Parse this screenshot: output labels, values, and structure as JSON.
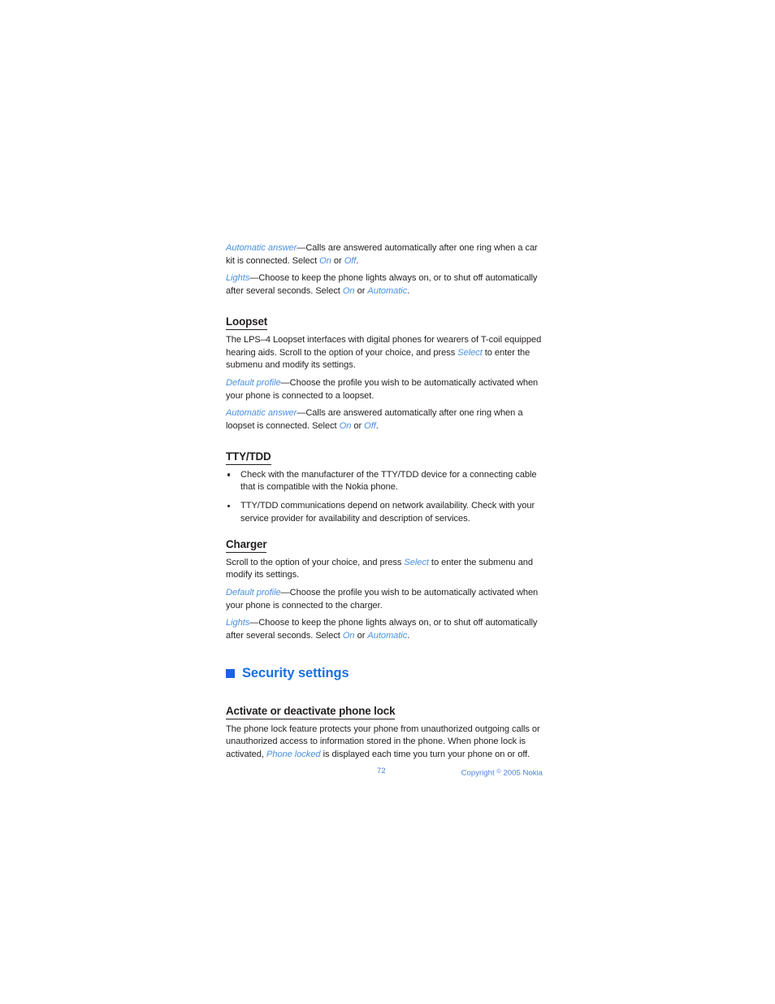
{
  "page": {
    "background_color": "#ffffff",
    "text_color": "#231f20",
    "accent_blue": "#4a90e2",
    "heading_blue": "#1a6fe0",
    "square_blue": "#1a62e8"
  },
  "intro": {
    "automatic_answer": {
      "term": "Automatic answer",
      "text_1": "—Calls are answered automatically after one ring when a car kit is connected. Select ",
      "option_1": "On",
      "conj": " or ",
      "option_2": "Off",
      "text_end": "."
    },
    "lights": {
      "term": "Lights",
      "text_1": "—Choose to keep the phone lights always on, or to shut off automatically after several seconds. Select ",
      "option_1": "On",
      "conj": " or ",
      "option_2": "Automatic",
      "text_end": "."
    }
  },
  "loopset": {
    "heading": "Loopset",
    "intro": {
      "text_1": "The LPS–4 Loopset interfaces with digital phones for wearers of T-coil equipped hearing aids. Scroll to the option of your choice, and press ",
      "keyword": "Select",
      "text_2": " to enter the submenu and modify its settings."
    },
    "default_profile": {
      "term": "Default profile",
      "text": "—Choose the profile you wish to be automatically activated when your phone is connected to a loopset."
    },
    "automatic_answer": {
      "term": "Automatic answer",
      "text_1": "—Calls are answered automatically after one ring when a loopset is connected. Select ",
      "option_1": "On",
      "conj": " or ",
      "option_2": "Off",
      "text_end": "."
    }
  },
  "tty_tdd": {
    "heading": "TTY/TDD",
    "bullets": [
      "Check with the manufacturer of the TTY/TDD device for a connecting cable that is compatible with the Nokia phone.",
      "TTY/TDD communications depend on network availability. Check with your service provider for availability and description of services."
    ]
  },
  "charger": {
    "heading": "Charger",
    "intro": {
      "text_1": "Scroll to the option of your choice, and press ",
      "keyword": "Select",
      "text_2": " to enter the submenu and modify its settings."
    },
    "default_profile": {
      "term": "Default profile",
      "text": "—Choose the profile you wish to be automatically activated when your phone is connected to the charger."
    },
    "lights": {
      "term": "Lights",
      "text_1": "—Choose to keep the phone lights always on, or to shut off automatically after several seconds. Select ",
      "option_1": "On",
      "conj": " or ",
      "option_2": "Automatic",
      "text_end": "."
    }
  },
  "security_settings": {
    "heading": "Security settings",
    "bullet_icon": "blue-square-icon",
    "activate_lock": {
      "heading": "Activate or deactivate phone lock",
      "text_1": "The phone lock feature protects your phone from unauthorized outgoing calls or unauthorized access to information stored in the phone. When phone lock is activated, ",
      "keyword": "Phone locked",
      "text_2": " is displayed each time you turn your phone on or off."
    }
  },
  "footer": {
    "page_number": "72",
    "copyright_prefix": "Copyright ",
    "copyright_symbol": "©",
    "copyright_suffix": " 2005 Nokia"
  }
}
